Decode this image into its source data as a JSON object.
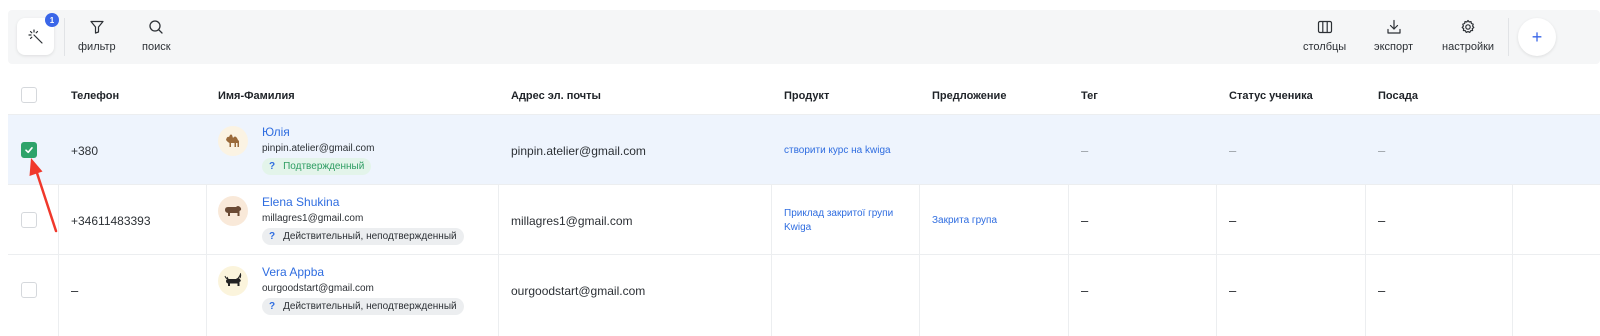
{
  "toolbar": {
    "magic_badge_count": "1",
    "filter_label": "фильтр",
    "search_label": "поиск",
    "columns_label": "столбцы",
    "export_label": "экспорт",
    "settings_label": "настройки",
    "add_label": "+"
  },
  "table": {
    "headers": [
      "Телефон",
      "Имя-Фамилия",
      "Адрес эл. почты",
      "Продукт",
      "Предложение",
      "Тег",
      "Статус ученика",
      "Посада"
    ],
    "rows": [
      {
        "selected": true,
        "phone": "+380",
        "name": "Юлія",
        "email_small": "pinpin.atelier@gmail.com",
        "badge_q": "?",
        "badge_text": "Подтвержденный",
        "email": "pinpin.atelier@gmail.com",
        "product_line1": "створити курс на kwiga",
        "product_line2": "",
        "offer": "",
        "tag": "–",
        "status": "–",
        "position": "–"
      },
      {
        "selected": false,
        "phone": "+34611483393",
        "name": "Elena Shukina",
        "email_small": "millagres1@gmail.com",
        "badge_q": "?",
        "badge_text": "Действительный, неподтвержденный",
        "email": "millagres1@gmail.com",
        "product_line1": "Приклад закритої групи",
        "product_line2": "Kwiga",
        "offer": "Закрита група",
        "tag": "–",
        "status": "–",
        "position": "–"
      },
      {
        "selected": false,
        "phone": "–",
        "name": "Vera Appba",
        "email_small": "ourgoodstart@gmail.com",
        "badge_q": "?",
        "badge_text": "Действительный, неподтвержденный",
        "email": "ourgoodstart@gmail.com",
        "product_line1": "",
        "product_line2": "",
        "offer": "",
        "tag": "–",
        "status": "–",
        "position": "–"
      }
    ]
  },
  "colors": {
    "accent": "#3a66e8",
    "link": "#2f6de0",
    "selected_row": "#eef4fd",
    "checkbox_on": "#2ea36a",
    "annotation_arrow": "#f0382b"
  },
  "icons": {
    "magic": "magic-wand-icon",
    "filter": "filter-icon",
    "search": "search-icon",
    "columns": "columns-icon",
    "export": "download-icon",
    "settings": "gear-icon",
    "avatars": [
      "camel-avatar-icon",
      "bear-avatar-icon",
      "bull-avatar-icon"
    ]
  }
}
